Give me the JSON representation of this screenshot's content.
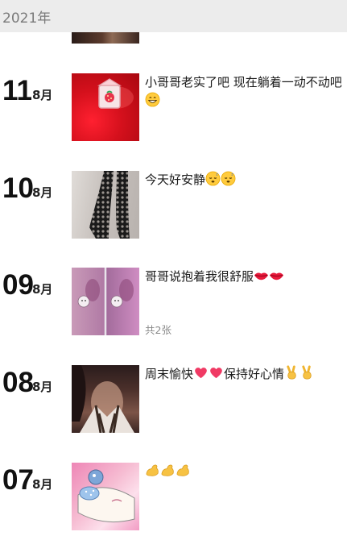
{
  "year_header": "2021年",
  "entries": [
    {
      "day": "11",
      "month": "8月",
      "text": "小哥哥老实了吧 现在躺着一动不动吧",
      "count": ""
    },
    {
      "day": "10",
      "month": "8月",
      "text": "今天好安静",
      "count": ""
    },
    {
      "day": "09",
      "month": "8月",
      "text": "哥哥说抱着我很舒服",
      "count": "共2张"
    },
    {
      "day": "08",
      "month": "8月",
      "text_a": "周末愉快",
      "text_b": "保持好心情",
      "count": ""
    },
    {
      "day": "07",
      "month": "8月",
      "text": "",
      "count": ""
    }
  ],
  "emoji": {
    "grin": "grinning-face-icon",
    "sleep": "sleeping-face-icon",
    "lips": "lips-icon",
    "heart": "heart-icon",
    "victory": "victory-hand-icon",
    "muscle": "flexed-biceps-icon"
  },
  "colors": {
    "year_bar": "#ececec",
    "text": "#1a1a1a",
    "muted": "#888888"
  }
}
